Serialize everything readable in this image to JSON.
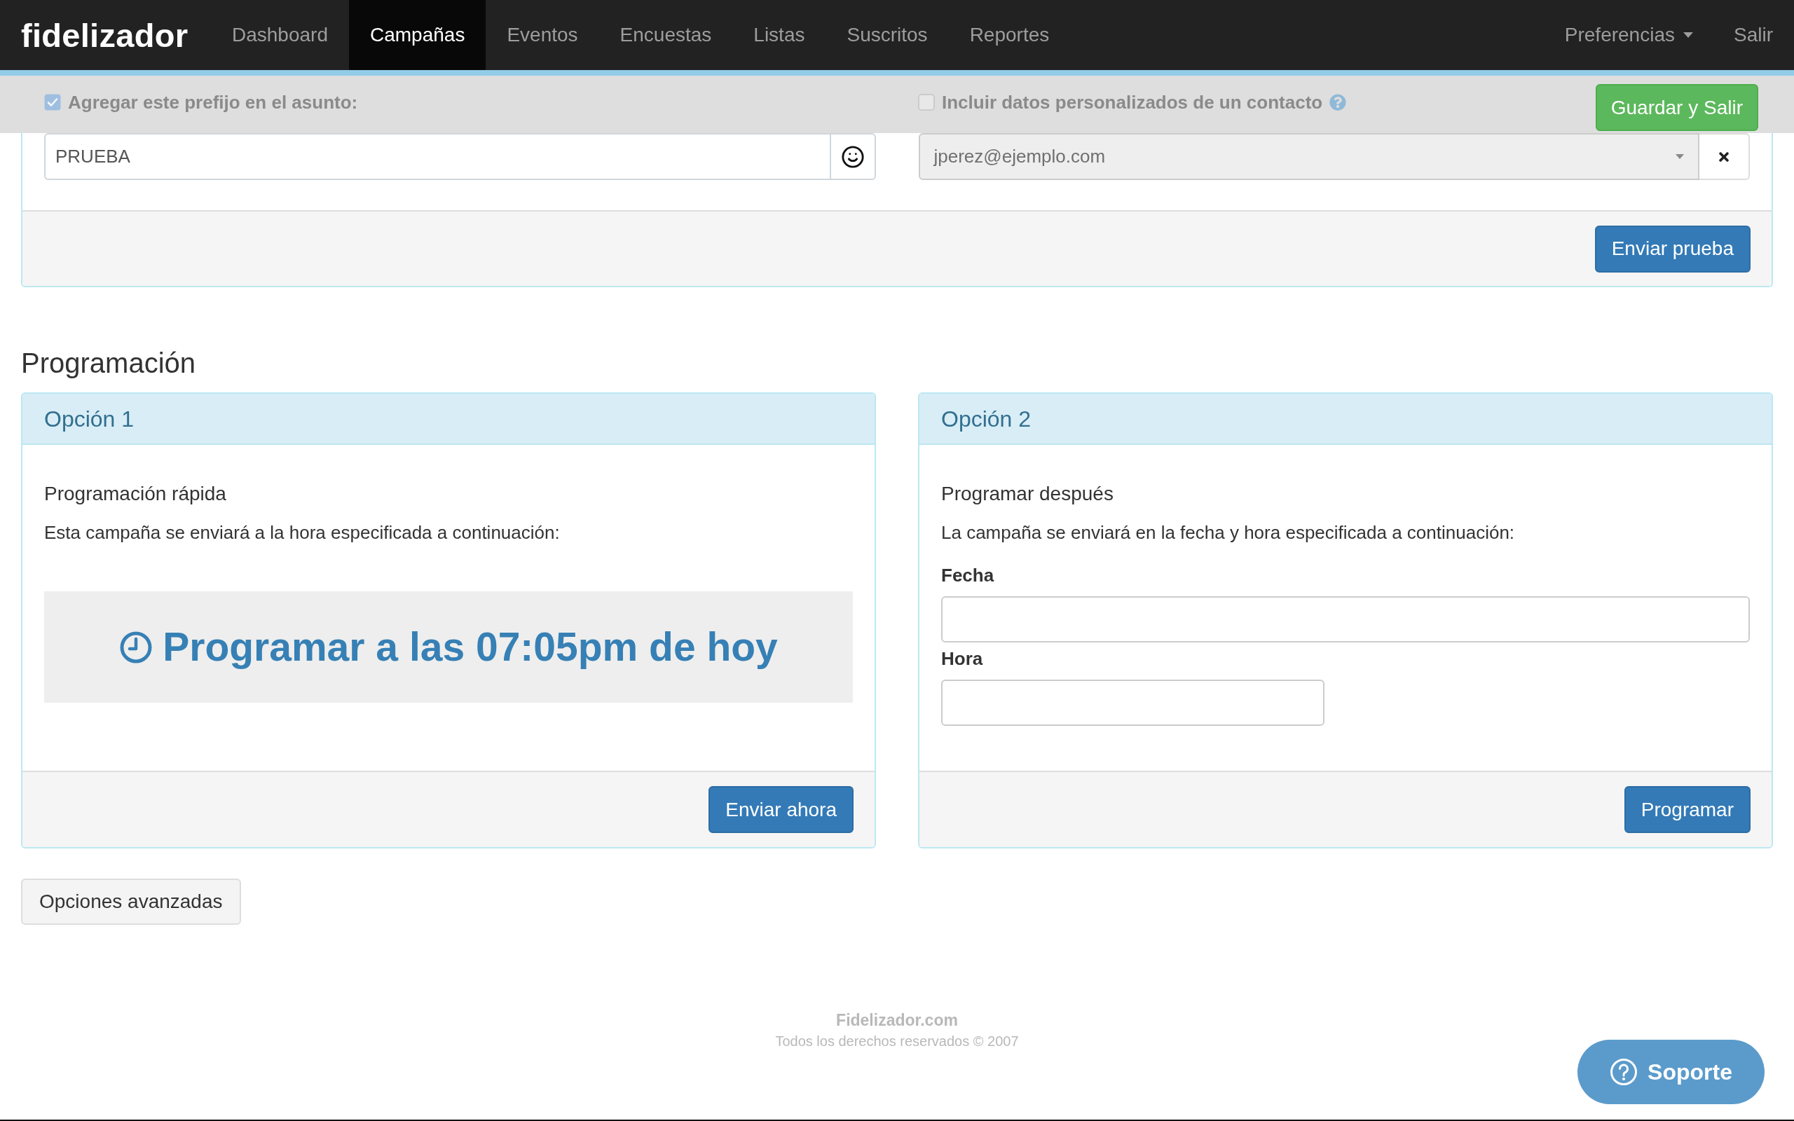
{
  "navbar": {
    "logo": "fidelizador",
    "items": [
      {
        "label": "Dashboard",
        "selected": false
      },
      {
        "label": "Campañas",
        "selected": true
      },
      {
        "label": "Eventos",
        "selected": false
      },
      {
        "label": "Encuestas",
        "selected": false
      },
      {
        "label": "Listas",
        "selected": false
      },
      {
        "label": "Suscritos",
        "selected": false
      },
      {
        "label": "Reportes",
        "selected": false
      }
    ],
    "right_items": [
      {
        "label": "Preferencias",
        "kind": "dropdown"
      },
      {
        "label": "Salir",
        "kind": "link"
      }
    ]
  },
  "toolbar": {
    "button": "Guardar y Salir"
  },
  "test_panel": {
    "prefix": {
      "label": "Agregar este prefijo en el asunto:",
      "checked": true,
      "value": "PRUEBA"
    },
    "contact": {
      "label": "Incluir datos personalizados de un contacto",
      "checked": false,
      "value": "jperez@ejemplo.com"
    },
    "button": "Enviar prueba"
  },
  "scheduling": {
    "title": "Programación",
    "options": [
      {
        "kind": "quick",
        "header": "Opción 1",
        "title": "Programación rápida",
        "description": "Esta campaña se enviará a la hora especificada a continuación:",
        "schedule_text": "Programar a las 07:05pm de hoy",
        "button": "Enviar ahora"
      },
      {
        "kind": "later",
        "header": "Opción 2",
        "title": "Programar después",
        "description": "La campaña se enviará en la fecha y hora especificada a continuación:",
        "fields": [
          {
            "label": "Fecha"
          },
          {
            "label": "Hora"
          }
        ],
        "button": "Programar"
      }
    ],
    "advanced_button": "Opciones avanzadas"
  },
  "footer": {
    "site": "Fidelizador.com",
    "copyright": "Todos los derechos reservados © 2007"
  },
  "support_button": "Soporte"
}
